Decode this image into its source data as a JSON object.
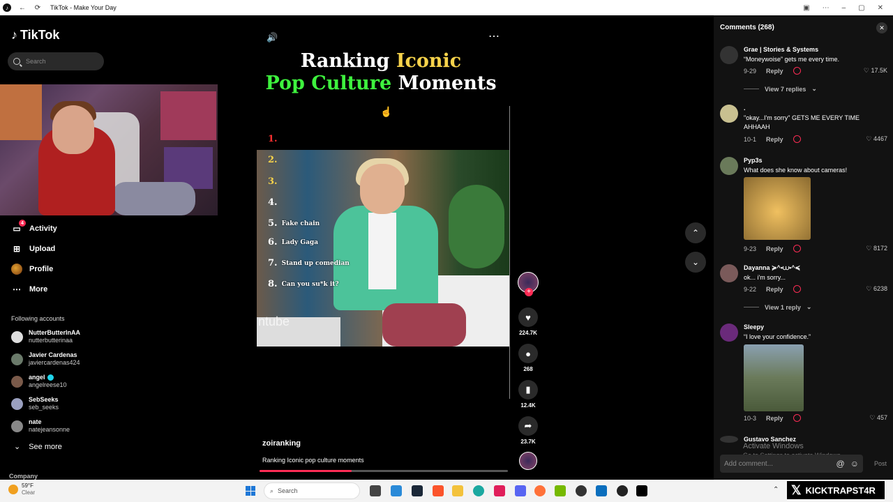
{
  "window": {
    "title": "TikTok - Make Your Day"
  },
  "sidebar": {
    "logo": "TikTok",
    "search_placeholder": "Search",
    "nav": [
      {
        "label": "Activity",
        "icon": "activity-icon",
        "badge": "4"
      },
      {
        "label": "Upload",
        "icon": "upload-icon"
      },
      {
        "label": "Profile",
        "icon": "profile-icon"
      },
      {
        "label": "More",
        "icon": "more-icon"
      }
    ],
    "following_title": "Following accounts",
    "following": [
      {
        "name": "NutterButterInAA",
        "handle": "nutterbutterinaa",
        "verified": false
      },
      {
        "name": "Javier Cardenas",
        "handle": "javiercardenas424",
        "verified": false
      },
      {
        "name": "angel",
        "handle": "angelreese10",
        "verified": true
      },
      {
        "name": "SebSeeks",
        "handle": "seb_seeks",
        "verified": false
      },
      {
        "name": "nate",
        "handle": "natejeansonne",
        "verified": false
      }
    ],
    "see_more": "See more",
    "company": "Company"
  },
  "video": {
    "headline_line1_a": "Ranking ",
    "headline_line1_b": "Iconic",
    "headline_line2_a": "Pop Culture",
    "headline_line2_b": " Moments",
    "ranks": [
      {
        "num": "1.",
        "label": ""
      },
      {
        "num": "2.",
        "label": ""
      },
      {
        "num": "3.",
        "label": ""
      },
      {
        "num": "4.",
        "label": ""
      },
      {
        "num": "5.",
        "label": "Fake chain"
      },
      {
        "num": "6.",
        "label": "Lady Gaga"
      },
      {
        "num": "7.",
        "label": "Stand up comedian"
      },
      {
        "num": "8.",
        "label": "Can you su*k it?"
      }
    ],
    "watermark": "ntube",
    "author": "zoiranking",
    "description": "Ranking Iconic pop culture moments",
    "progress": 0.37,
    "likes": "224.7K",
    "comments": "268",
    "saves": "12.4K",
    "shares": "23.7K"
  },
  "comments_panel": {
    "title": "Comments (268)",
    "add_placeholder": "Add comment...",
    "post_label": "Post",
    "reply_label": "Reply",
    "items": [
      {
        "user": "Grae | Stories & Systems",
        "text": "“Moneywoise” gets me every time.",
        "date": "9-29",
        "likes": "17.5K",
        "view_replies": "View 7 replies"
      },
      {
        "user": ".",
        "text": "\"okay...I'm sorry\" GETS ME EVERY TIME AHHAAH",
        "date": "10-1",
        "likes": "4467"
      },
      {
        "user": "Pyp3s",
        "text": "What does she know about cameras!",
        "date": "9-23",
        "likes": "8172"
      },
      {
        "user": "Dayanna ≽^•⩊•^≼",
        "text": "ok... i'm sorry...",
        "date": "9-22",
        "likes": "6238",
        "view_replies": "View 1 reply"
      },
      {
        "user": "Sleepy",
        "text": "“I love your confidence.”",
        "date": "10-3",
        "likes": "457"
      },
      {
        "user": "Gustavo Sanchez",
        "text": "",
        "date": "",
        "likes": ""
      }
    ],
    "activate_title": "Activate Windows",
    "activate_sub": "Go to Settings to activate Windows."
  },
  "taskbar": {
    "temp": "59°F",
    "condition": "Clear",
    "search": "Search",
    "overlay": "KICKTRAPST4R"
  }
}
